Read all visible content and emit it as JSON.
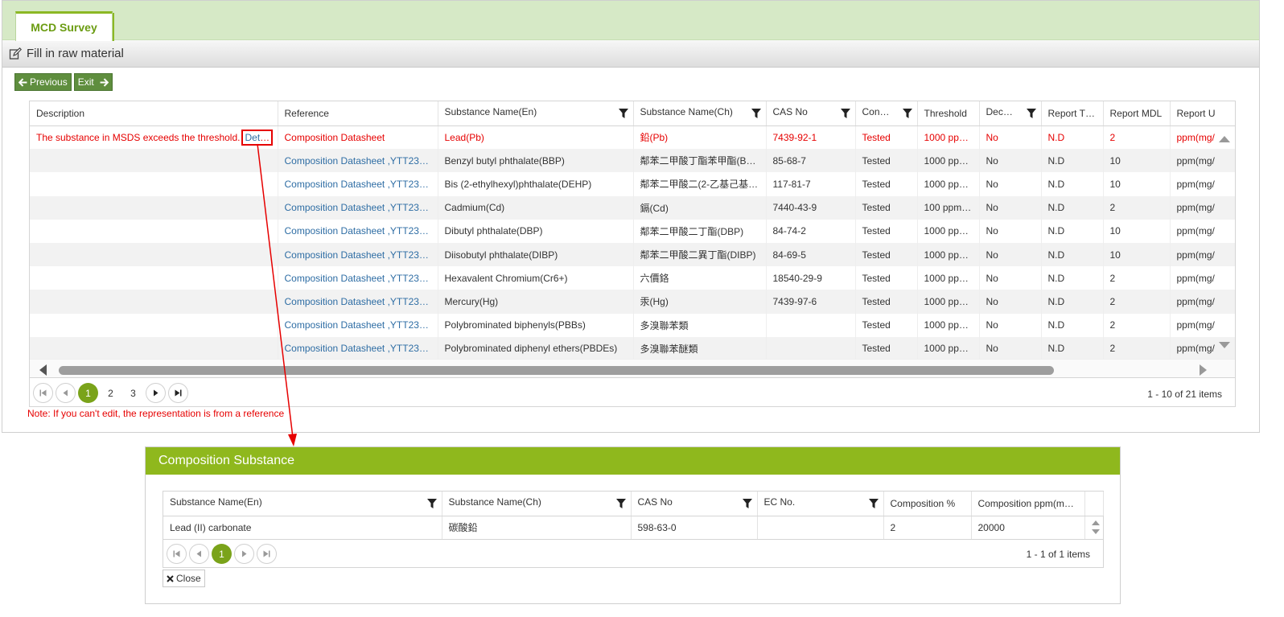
{
  "tabs": [
    {
      "label": "MCD Survey"
    }
  ],
  "section": {
    "title": "Fill in raw material"
  },
  "buttons": {
    "previous": "Previous",
    "exit": "Exit"
  },
  "grid": {
    "columns": [
      "Description",
      "Reference",
      "Substance Name(En)",
      "Substance Name(Ch)",
      "CAS No",
      "Con…",
      "Threshold",
      "Dec…",
      "Report T…",
      "Report MDL",
      "Report U"
    ],
    "rows": [
      {
        "description": "The substance in MSDS exceeds the threshold.",
        "detail": "Detail",
        "reference": "Composition Datasheet",
        "name_en": "Lead(Pb)",
        "name_ch": "鉛(Pb)",
        "cas": "7439-92-1",
        "con": "Tested",
        "threshold": "1000 pp…",
        "dec": "No",
        "report_t": "N.D",
        "mdl": "2",
        "unit": "ppm(mg/"
      },
      {
        "description": "",
        "detail": "",
        "reference": "Composition Datasheet ,YTT23…",
        "name_en": "Benzyl butyl phthalate(BBP)",
        "name_ch": "鄰苯二甲酸丁酯苯甲酯(B…",
        "cas": "85-68-7",
        "con": "Tested",
        "threshold": "1000 pp…",
        "dec": "No",
        "report_t": "N.D",
        "mdl": "10",
        "unit": "ppm(mg/"
      },
      {
        "description": "",
        "detail": "",
        "reference": "Composition Datasheet ,YTT23…",
        "name_en": "Bis (2-ethylhexyl)phthalate(DEHP)",
        "name_ch": "鄰苯二甲酸二(2-乙基己基…",
        "cas": "117-81-7",
        "con": "Tested",
        "threshold": "1000 pp…",
        "dec": "No",
        "report_t": "N.D",
        "mdl": "10",
        "unit": "ppm(mg/"
      },
      {
        "description": "",
        "detail": "",
        "reference": "Composition Datasheet ,YTT23…",
        "name_en": "Cadmium(Cd)",
        "name_ch": "鎘(Cd)",
        "cas": "7440-43-9",
        "con": "Tested",
        "threshold": "100 ppm…",
        "dec": "No",
        "report_t": "N.D",
        "mdl": "2",
        "unit": "ppm(mg/"
      },
      {
        "description": "",
        "detail": "",
        "reference": "Composition Datasheet ,YTT23…",
        "name_en": "Dibutyl phthalate(DBP)",
        "name_ch": "鄰苯二甲酸二丁酯(DBP)",
        "cas": "84-74-2",
        "con": "Tested",
        "threshold": "1000 pp…",
        "dec": "No",
        "report_t": "N.D",
        "mdl": "10",
        "unit": "ppm(mg/"
      },
      {
        "description": "",
        "detail": "",
        "reference": "Composition Datasheet ,YTT23…",
        "name_en": "Diisobutyl phthalate(DIBP)",
        "name_ch": "鄰苯二甲酸二異丁酯(DIBP)",
        "cas": "84-69-5",
        "con": "Tested",
        "threshold": "1000 pp…",
        "dec": "No",
        "report_t": "N.D",
        "mdl": "10",
        "unit": "ppm(mg/"
      },
      {
        "description": "",
        "detail": "",
        "reference": "Composition Datasheet ,YTT23…",
        "name_en": "Hexavalent Chromium(Cr6+)",
        "name_ch": "六價鉻",
        "cas": "18540-29-9",
        "con": "Tested",
        "threshold": "1000 pp…",
        "dec": "No",
        "report_t": "N.D",
        "mdl": "2",
        "unit": "ppm(mg/"
      },
      {
        "description": "",
        "detail": "",
        "reference": "Composition Datasheet ,YTT23…",
        "name_en": "Mercury(Hg)",
        "name_ch": "汞(Hg)",
        "cas": "7439-97-6",
        "con": "Tested",
        "threshold": "1000 pp…",
        "dec": "No",
        "report_t": "N.D",
        "mdl": "2",
        "unit": "ppm(mg/"
      },
      {
        "description": "",
        "detail": "",
        "reference": "Composition Datasheet ,YTT23…",
        "name_en": "Polybrominated biphenyls(PBBs)",
        "name_ch": "多溴聯苯類",
        "cas": "",
        "con": "Tested",
        "threshold": "1000 pp…",
        "dec": "No",
        "report_t": "N.D",
        "mdl": "2",
        "unit": "ppm(mg/"
      },
      {
        "description": "",
        "detail": "",
        "reference": "Composition Datasheet ,YTT23…",
        "name_en": "Polybrominated diphenyl ethers(PBDEs)",
        "name_ch": "多溴聯苯醚類",
        "cas": "",
        "con": "Tested",
        "threshold": "1000 pp…",
        "dec": "No",
        "report_t": "N.D",
        "mdl": "2",
        "unit": "ppm(mg/"
      }
    ],
    "pager": {
      "pages": [
        "1",
        "2",
        "3"
      ],
      "info": "1 - 10 of 21 items"
    },
    "note": "Note: If you can't edit, the representation is from a reference"
  },
  "popup": {
    "title": "Composition Substance",
    "columns": [
      "Substance Name(En)",
      "Substance Name(Ch)",
      "CAS No",
      "EC No.",
      "Composition %",
      "Composition ppm(m…"
    ],
    "rows": [
      {
        "name_en": "Lead (II) carbonate",
        "name_ch": "碳酸鉛",
        "cas": "598-63-0",
        "ec": "",
        "pct": "2",
        "ppm": "20000"
      }
    ],
    "pager": {
      "pages": [
        "1"
      ],
      "info": "1 - 1 of 1 items"
    },
    "close": "Close"
  },
  "colors": {
    "accent": "#8fb81d",
    "highlight": "#e60000",
    "link": "#2e6da4",
    "tabbar": "#d6e9c6"
  },
  "icons": [
    "edit-icon",
    "arrow-left-icon",
    "arrow-right-icon",
    "filter-icon",
    "first-page-icon",
    "prev-page-icon",
    "next-page-icon",
    "last-page-icon",
    "close-icon",
    "sort-arrows-icon"
  ]
}
